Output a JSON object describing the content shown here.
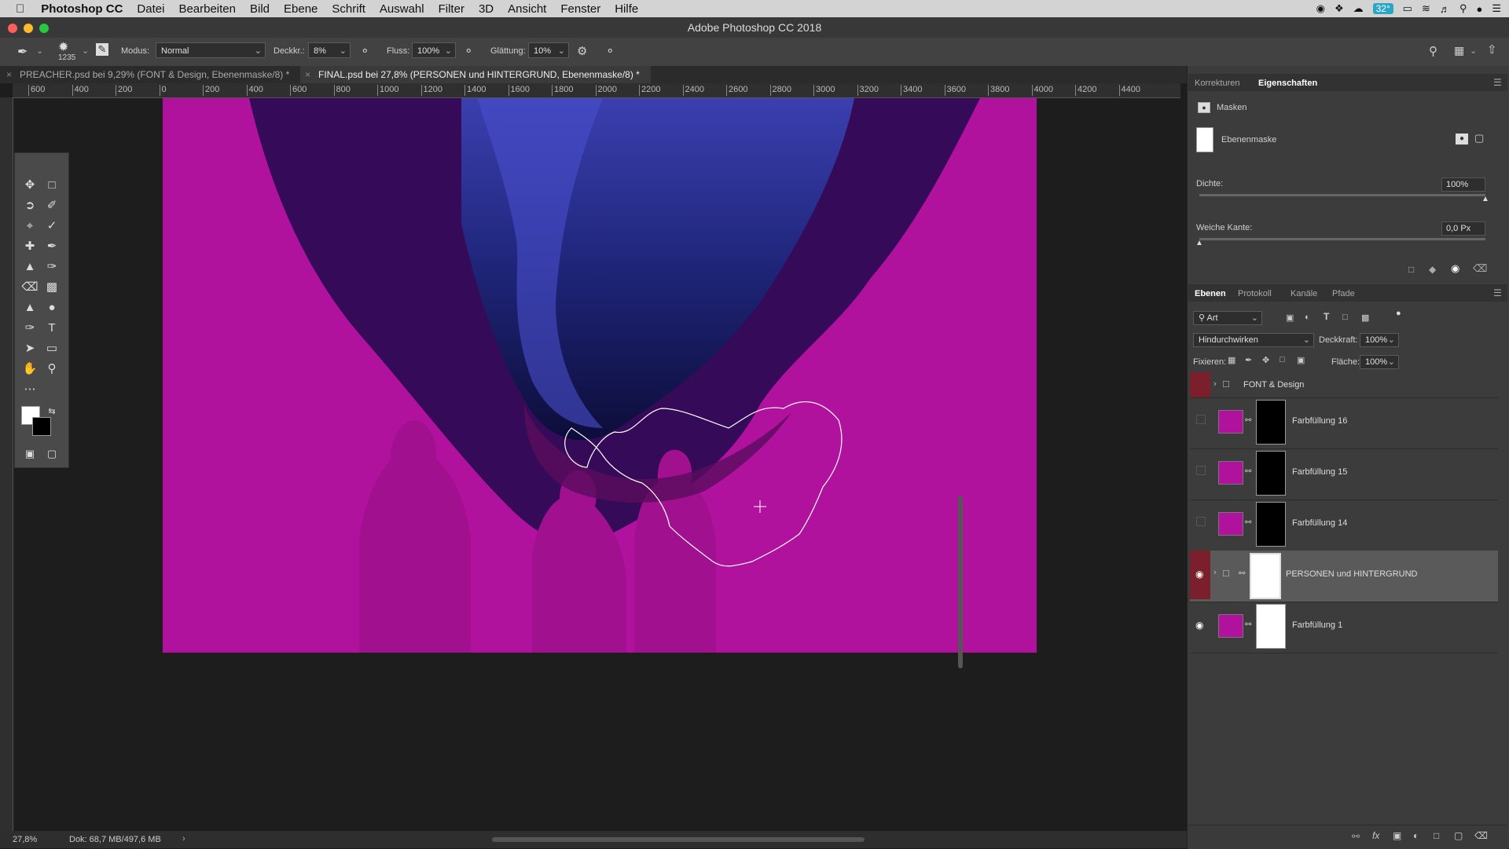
{
  "menubar": {
    "app_name": "Photoshop CC",
    "items": [
      "Datei",
      "Bearbeiten",
      "Bild",
      "Ebene",
      "Schrift",
      "Auswahl",
      "Filter",
      "3D",
      "Ansicht",
      "Fenster",
      "Hilfe"
    ],
    "temperature": "32°"
  },
  "window": {
    "title": "Adobe Photoshop CC 2018"
  },
  "options": {
    "brush_size": "1235",
    "mode_label": "Modus:",
    "mode_value": "Normal",
    "opacity_label": "Deckkr.:",
    "opacity_value": "8%",
    "flow_label": "Fluss:",
    "flow_value": "100%",
    "smoothing_label": "Glättung:",
    "smoothing_value": "10%"
  },
  "tabs": [
    {
      "label": "PREACHER.psd bei 9,29% (FONT & Design, Ebenenmaske/8) *",
      "active": false
    },
    {
      "label": "FINAL.psd bei 27,8% (PERSONEN und HINTERGRUND, Ebenenmaske/8) *",
      "active": true
    }
  ],
  "ruler": {
    "h_ticks": [
      "600",
      "400",
      "200",
      "0",
      "200",
      "400",
      "600",
      "800",
      "1000",
      "1200",
      "1400",
      "1600",
      "1800",
      "2000",
      "2200",
      "2400",
      "2600",
      "2800",
      "3000",
      "3200",
      "3400",
      "3600",
      "3800",
      "4000",
      "4200",
      "4400"
    ]
  },
  "status": {
    "zoom": "27,8%",
    "doc": "Dok: 68,7 MB/497,6 MB"
  },
  "properties": {
    "tab_corrections": "Korrekturen",
    "tab_properties": "Eigenschaften",
    "section": "Masken",
    "mask_type": "Ebenenmaske",
    "density_label": "Dichte:",
    "density_value": "100%",
    "density_fraction": 1.0,
    "feather_label": "Weiche Kante:",
    "feather_value": "0,0 Px",
    "feather_fraction": 0.0
  },
  "layers_panel": {
    "tabs": [
      "Ebenen",
      "Protokoll",
      "Kanäle",
      "Pfade"
    ],
    "filter_value": "Art",
    "blend_mode": "Hindurchwirken",
    "opacity_label": "Deckkraft:",
    "opacity_value": "100%",
    "lock_label": "Fixieren:",
    "fill_label": "Fläche:",
    "fill_value": "100%",
    "layers": [
      {
        "name": "FONT & Design",
        "type": "group",
        "visible": false
      },
      {
        "name": "Farbfüllung 16",
        "type": "fill",
        "visible": false
      },
      {
        "name": "Farbfüllung 15",
        "type": "fill",
        "visible": false
      },
      {
        "name": "Farbfüllung 14",
        "type": "fill",
        "visible": false
      },
      {
        "name": "PERSONEN und HINTERGRUND",
        "type": "group",
        "visible": true,
        "selected": true
      },
      {
        "name": "Farbfüllung 1",
        "type": "fill",
        "visible": true
      }
    ]
  },
  "colors": {
    "magenta": "#b0129e",
    "deep_blue": "#1e2a8c",
    "ui_dark": "#3c3c3c"
  }
}
